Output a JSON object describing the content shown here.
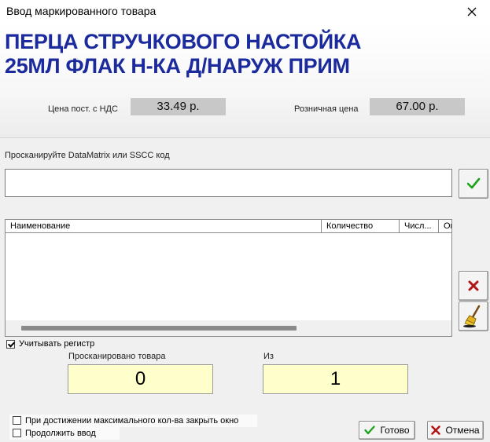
{
  "window": {
    "title": "Ввод маркированного товара",
    "close_icon": "close-icon"
  },
  "product": {
    "name_line1": "ПЕРЦА СТРУЧКОВОГО НАСТОЙКА",
    "name_line2": "25МЛ ФЛАК Н-КА Д/НАРУЖ ПРИМ"
  },
  "prices": {
    "supplier_label": "Цена пост. с НДС",
    "supplier_value": "33.49 р.",
    "retail_label": "Розничная цена",
    "retail_value": "67.00 р."
  },
  "scan": {
    "label": "Просканируйте DataMatrix или SSCC код",
    "value": "",
    "placeholder": ""
  },
  "table": {
    "columns": [
      "Наименование",
      "Количество",
      "Числ...",
      "Ог"
    ],
    "rows": []
  },
  "options": {
    "case_sensitive_label": "Учитывать регистр",
    "case_sensitive_checked": true,
    "close_on_max_label": "При достижении максимального кол-ва закрыть окно",
    "close_on_max_checked": false,
    "continue_input_label": "Продолжить ввод",
    "continue_input_checked": false
  },
  "counters": {
    "scanned_label": "Просканировано товара",
    "scanned_value": "0",
    "total_label": "Из",
    "total_value": "1"
  },
  "buttons": {
    "ok_label": "Готово",
    "cancel_label": "Отмена"
  },
  "colors": {
    "product_name": "#1b2a9c",
    "check_green": "#1aa31a",
    "delete_red": "#b01515",
    "counter_bg": "#ffffcc",
    "price_bg": "#c8c8c8"
  }
}
